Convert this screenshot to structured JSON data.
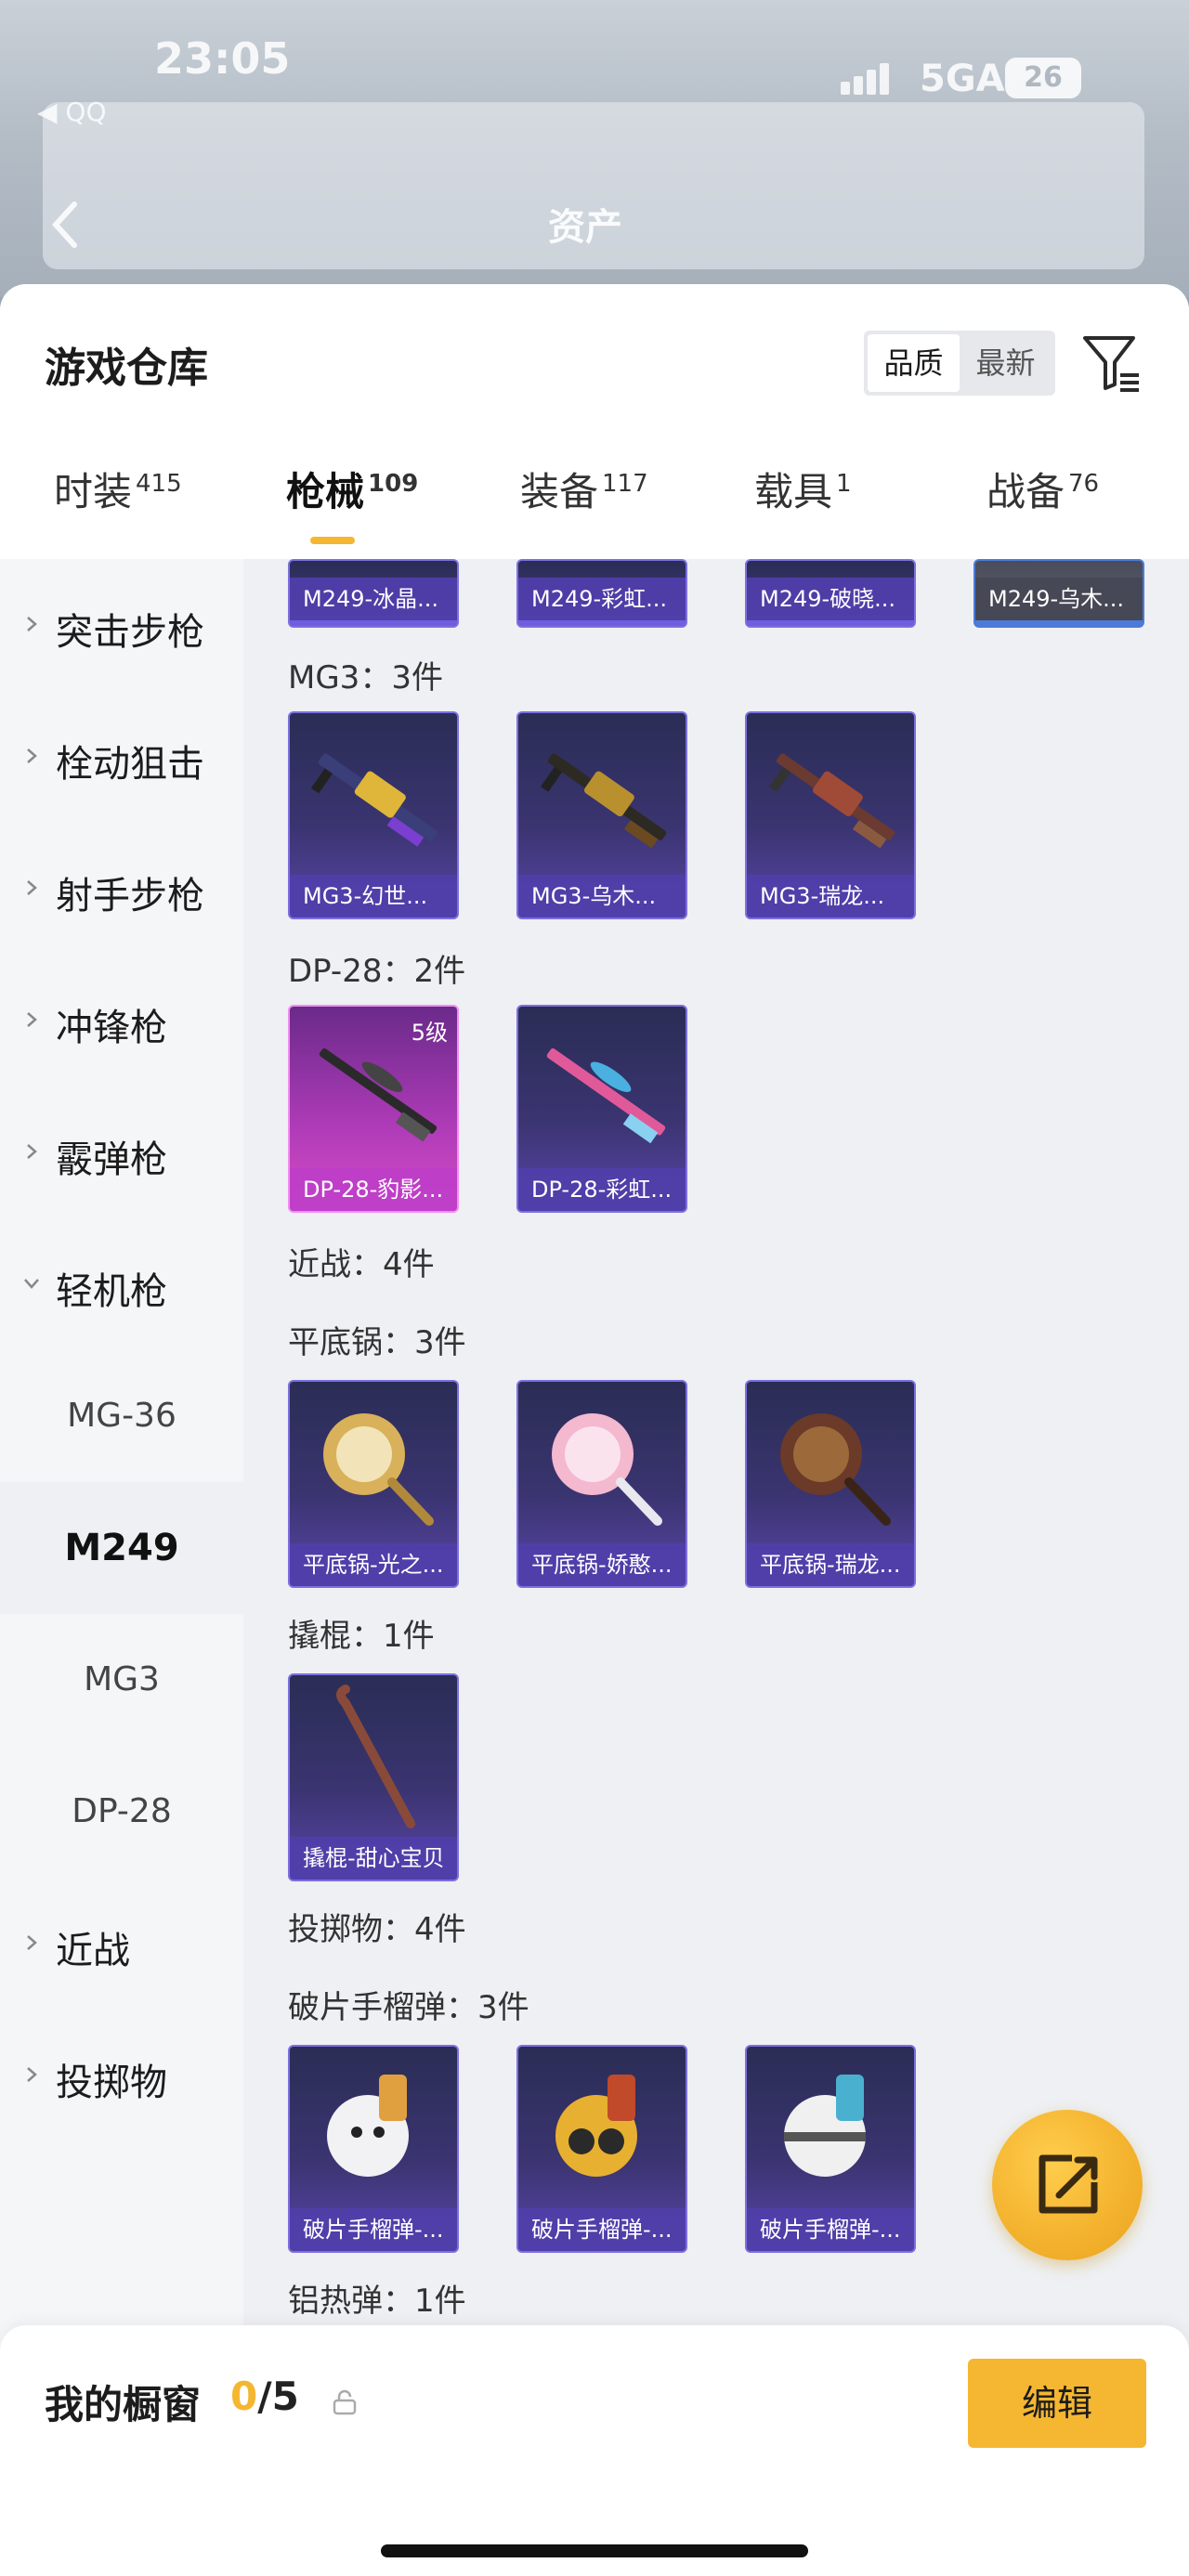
{
  "status": {
    "time": "23:05",
    "back_app": "◀ QQ",
    "network": "5GA",
    "battery": "26"
  },
  "background": {
    "title": "资产"
  },
  "header": {
    "title": "游戏仓库",
    "sort": [
      "品质",
      "最新"
    ],
    "active_sort": 0
  },
  "tabs": [
    {
      "label": "时装",
      "count": "415"
    },
    {
      "label": "枪械",
      "count": "109"
    },
    {
      "label": "装备",
      "count": "117"
    },
    {
      "label": "载具",
      "count": "1"
    },
    {
      "label": "战备",
      "count": "76"
    }
  ],
  "active_tab": 1,
  "sidebar": {
    "categories": [
      "突击步枪",
      "栓动狙击",
      "射手步枪",
      "冲锋枪",
      "霰弹枪",
      "轻机枪"
    ],
    "sub_items": [
      "MG-36",
      "M249",
      "MG3",
      "DP-28"
    ],
    "active_sub": "M249",
    "after": [
      "近战",
      "投掷物"
    ]
  },
  "content": {
    "m249_partial": [
      "M249-冰晶...",
      "M249-彩虹...",
      "M249-破晓...",
      "M249-乌木..."
    ],
    "groups": [
      {
        "label": "MG3：3件",
        "items": [
          "MG3-幻世...",
          "MG3-乌木...",
          "MG3-瑞龙..."
        ]
      },
      {
        "label": "DP-28：2件",
        "items": [
          "DP-28-豹影...",
          "DP-28-彩虹..."
        ],
        "badge": "5级"
      },
      {
        "label": "近战：4件",
        "items": []
      },
      {
        "label": "平底锅：3件",
        "items": [
          "平底锅-光之...",
          "平底锅-娇憨...",
          "平底锅-瑞龙..."
        ]
      },
      {
        "label": "撬棍：1件",
        "items": [
          "撬棍-甜心宝贝"
        ]
      },
      {
        "label": "投掷物：4件",
        "items": []
      },
      {
        "label": "破片手榴弹：3件",
        "items": [
          "破片手榴弹-...",
          "破片手榴弹-...",
          "破片手榴弹-..."
        ]
      },
      {
        "label": "铝热弹：1件",
        "items": []
      }
    ]
  },
  "bottom": {
    "showcase_label": "我的橱窗",
    "current": "0",
    "total": "/5",
    "edit_label": "编辑"
  },
  "colors": {
    "accent": "#f5b731",
    "card_purple": "#5a45a8",
    "card_pink": "#d64fc5"
  }
}
